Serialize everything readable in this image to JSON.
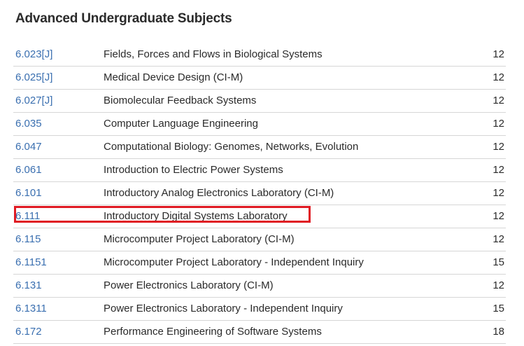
{
  "heading": "Advanced Undergraduate Subjects",
  "highlight_color": "#e01b24",
  "link_color": "#3a6fb0",
  "subjects": [
    {
      "code": "6.023[J]",
      "title": "Fields, Forces and Flows in Biological Systems",
      "units": "12"
    },
    {
      "code": "6.025[J]",
      "title": "Medical Device Design (CI-M)",
      "units": "12"
    },
    {
      "code": "6.027[J]",
      "title": "Biomolecular Feedback Systems",
      "units": "12"
    },
    {
      "code": "6.035",
      "title": "Computer Language Engineering",
      "units": "12"
    },
    {
      "code": "6.047",
      "title": "Computational Biology: Genomes, Networks, Evolution",
      "units": "12"
    },
    {
      "code": "6.061",
      "title": "Introduction to Electric Power Systems",
      "units": "12"
    },
    {
      "code": "6.101",
      "title": "Introductory Analog Electronics Laboratory (CI-M)",
      "units": "12"
    },
    {
      "code": "6.111",
      "title": "Introductory Digital Systems Laboratory",
      "units": "12"
    },
    {
      "code": "6.115",
      "title": "Microcomputer Project Laboratory (CI-M)",
      "units": "12"
    },
    {
      "code": "6.1151",
      "title": "Microcomputer Project Laboratory - Independent Inquiry",
      "units": "15"
    },
    {
      "code": "6.131",
      "title": "Power Electronics Laboratory (CI-M)",
      "units": "12"
    },
    {
      "code": "6.1311",
      "title": "Power Electronics Laboratory - Independent Inquiry",
      "units": "15"
    },
    {
      "code": "6.172",
      "title": "Performance Engineering of Software Systems",
      "units": "18"
    }
  ]
}
